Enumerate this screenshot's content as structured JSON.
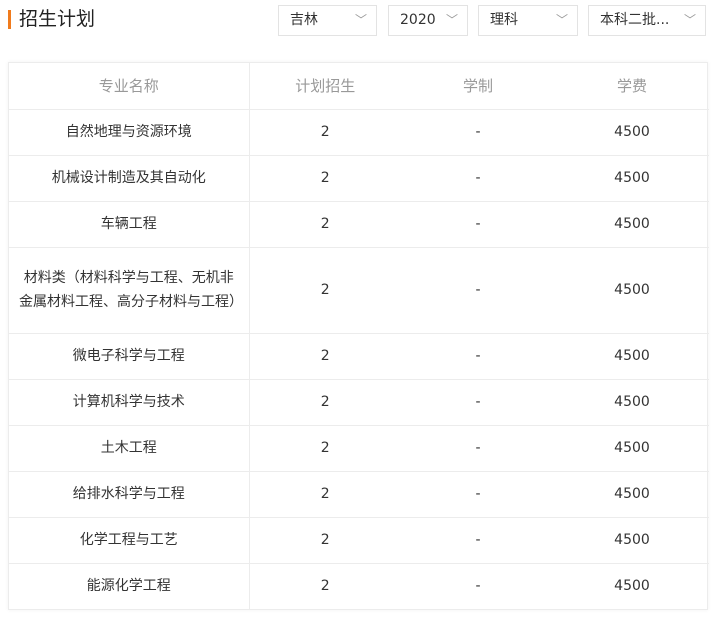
{
  "header": {
    "title": "招生计划"
  },
  "filters": [
    {
      "value": "吉林"
    },
    {
      "value": "2020"
    },
    {
      "value": "理科"
    },
    {
      "value": "本科二批..."
    }
  ],
  "table": {
    "columns": [
      "专业名称",
      "计划招生",
      "学制",
      "学费"
    ],
    "rows": [
      {
        "major": "自然地理与资源环境",
        "plan": "2",
        "duration": "-",
        "fee": "4500"
      },
      {
        "major": "机械设计制造及其自动化",
        "plan": "2",
        "duration": "-",
        "fee": "4500"
      },
      {
        "major": "车辆工程",
        "plan": "2",
        "duration": "-",
        "fee": "4500"
      },
      {
        "major": "材料类（材料科学与工程、无机非金属材料工程、高分子材料与工程）",
        "plan": "2",
        "duration": "-",
        "fee": "4500"
      },
      {
        "major": "微电子科学与工程",
        "plan": "2",
        "duration": "-",
        "fee": "4500"
      },
      {
        "major": "计算机科学与技术",
        "plan": "2",
        "duration": "-",
        "fee": "4500"
      },
      {
        "major": "土木工程",
        "plan": "2",
        "duration": "-",
        "fee": "4500"
      },
      {
        "major": "给排水科学与工程",
        "plan": "2",
        "duration": "-",
        "fee": "4500"
      },
      {
        "major": "化学工程与工艺",
        "plan": "2",
        "duration": "-",
        "fee": "4500"
      },
      {
        "major": "能源化学工程",
        "plan": "2",
        "duration": "-",
        "fee": "4500"
      }
    ]
  },
  "colors": {
    "accent": "#f07b1d",
    "header_text": "#999999",
    "border": "#ececec"
  },
  "icons": {
    "dropdown": "chevron-down-icon"
  }
}
